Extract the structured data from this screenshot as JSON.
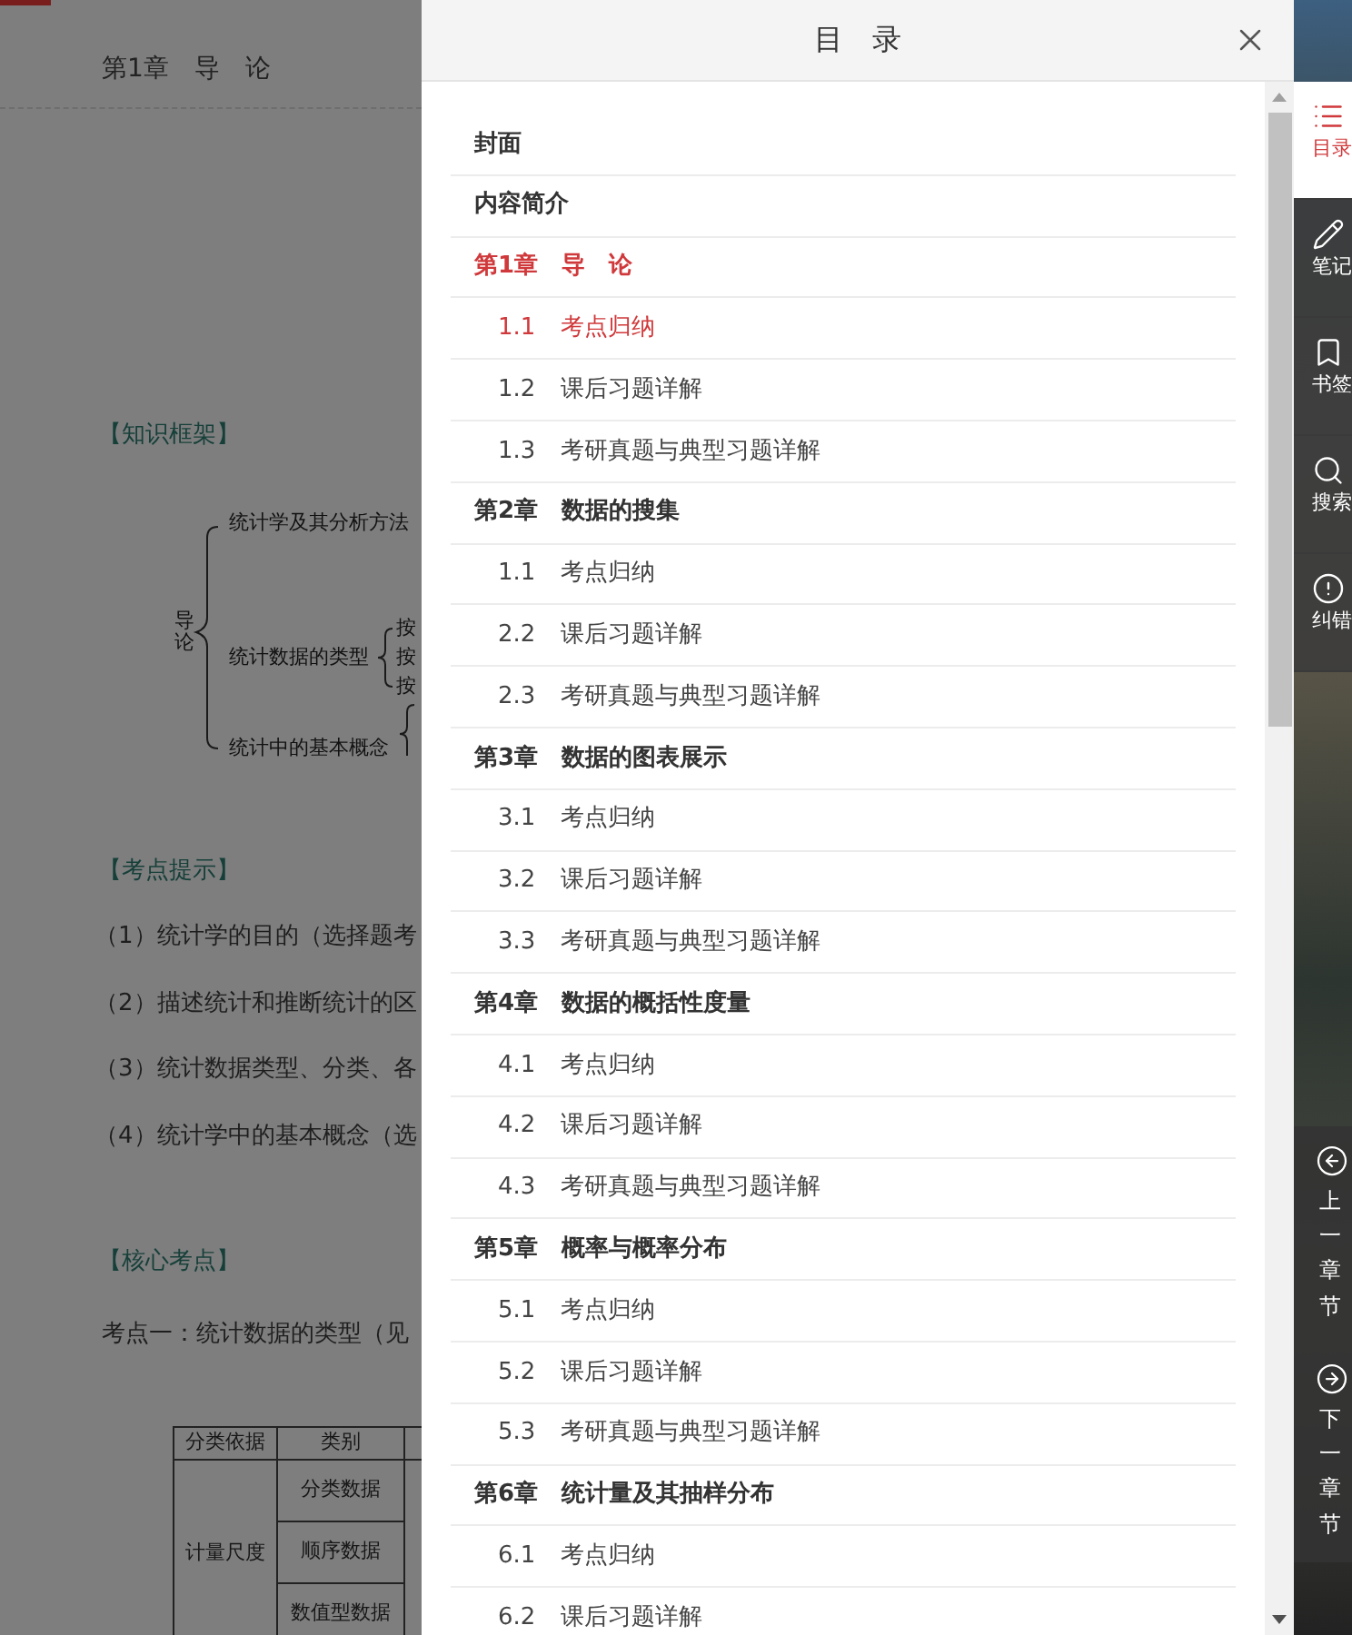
{
  "page": {
    "chapter_title": "第1章　导　论",
    "framework_heading": "【知识框架】",
    "diagram": {
      "root": "导论",
      "branches": [
        "统计学及其分析方法",
        "统计数据的类型",
        "统计中的基本概念"
      ],
      "sub_items": [
        "按",
        "按",
        "按"
      ]
    },
    "tips_heading": "【考点提示】",
    "tips": [
      "（1）统计学的目的（选择题考",
      "（2）描述统计和推断统计的区",
      "（3）统计数据类型、分类、各",
      "（4）统计学中的基本概念（选"
    ],
    "core_heading": "【核心考点】",
    "core_point": "考点一：统计数据的类型（见",
    "table": {
      "columns": [
        "分类依据",
        "类别"
      ],
      "group": "计量尺度",
      "rows": [
        "分类数据",
        "顺序数据",
        "数值型数据"
      ]
    }
  },
  "toc": {
    "title": "目　录",
    "items": [
      {
        "label": "封面",
        "selected": false
      },
      {
        "label": "内容简介",
        "selected": false
      },
      {
        "label": "第1章　导　论",
        "selected": true,
        "children": [
          {
            "number": "1.1",
            "title": "考点归纳",
            "selected": true
          },
          {
            "number": "1.2",
            "title": "课后习题详解",
            "selected": false
          },
          {
            "number": "1.3",
            "title": "考研真题与典型习题详解",
            "selected": false
          }
        ]
      },
      {
        "label": "第2章　数据的搜集",
        "selected": false,
        "children": [
          {
            "number": "1.1",
            "title": "考点归纳",
            "selected": false
          },
          {
            "number": "2.2",
            "title": "课后习题详解",
            "selected": false
          },
          {
            "number": "2.3",
            "title": "考研真题与典型习题详解",
            "selected": false
          }
        ]
      },
      {
        "label": "第3章　数据的图表展示",
        "selected": false,
        "children": [
          {
            "number": "3.1",
            "title": "考点归纳",
            "selected": false
          },
          {
            "number": "3.2",
            "title": "课后习题详解",
            "selected": false
          },
          {
            "number": "3.3",
            "title": "考研真题与典型习题详解",
            "selected": false
          }
        ]
      },
      {
        "label": "第4章　数据的概括性度量",
        "selected": false,
        "children": [
          {
            "number": "4.1",
            "title": "考点归纳",
            "selected": false
          },
          {
            "number": "4.2",
            "title": "课后习题详解",
            "selected": false
          },
          {
            "number": "4.3",
            "title": "考研真题与典型习题详解",
            "selected": false
          }
        ]
      },
      {
        "label": "第5章　概率与概率分布",
        "selected": false,
        "children": [
          {
            "number": "5.1",
            "title": "考点归纳",
            "selected": false
          },
          {
            "number": "5.2",
            "title": "课后习题详解",
            "selected": false
          },
          {
            "number": "5.3",
            "title": "考研真题与典型习题详解",
            "selected": false
          }
        ]
      },
      {
        "label": "第6章　统计量及其抽样分布",
        "selected": false,
        "children": [
          {
            "number": "6.1",
            "title": "考点归纳",
            "selected": false
          },
          {
            "number": "6.2",
            "title": "课后习题详解",
            "selected": false
          }
        ]
      }
    ]
  },
  "sidebar": {
    "items": [
      {
        "kind": "list",
        "label": "目录",
        "selected": true
      },
      {
        "kind": "pencil",
        "label": "笔记",
        "selected": false
      },
      {
        "kind": "bookmark",
        "label": "书签",
        "selected": false
      },
      {
        "kind": "search",
        "label": "搜索",
        "selected": false
      },
      {
        "kind": "alert",
        "label": "纠错",
        "selected": false
      }
    ],
    "nav": [
      {
        "kind": "prev",
        "label": "上一章节"
      },
      {
        "kind": "next",
        "label": "下一章节"
      }
    ]
  }
}
